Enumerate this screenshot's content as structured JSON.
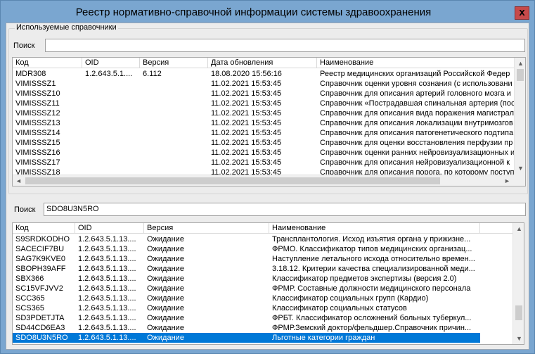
{
  "window": {
    "title": "Реестр нормативно-справочной информации системы здравоохранения",
    "close_glyph": "x"
  },
  "used": {
    "group_caption": "Используемые справочники",
    "search_label": "Поиск",
    "search_value": "",
    "columns": [
      "Код",
      "OID",
      "Версия",
      "Дата обновления",
      "Наименование"
    ],
    "rows": [
      [
        "MDR308",
        "1.2.643.5.1....",
        "6.112",
        "18.08.2020 15:56:16",
        "Реестр медицинских организаций Российской Федер"
      ],
      [
        "VIMISSSZ1",
        "",
        "",
        "11.02.2021 15:53:45",
        "Справочник оценки уровня сознания (с использовани"
      ],
      [
        "VIMISSSZ10",
        "",
        "",
        "11.02.2021 15:53:45",
        "Справочник для описания артерий головного мозга и"
      ],
      [
        "VIMISSSZ11",
        "",
        "",
        "11.02.2021 15:53:45",
        "Справочник «Пострадавшая спинальная артерия (пос"
      ],
      [
        "VIMISSSZ12",
        "",
        "",
        "11.02.2021 15:53:45",
        "Справочник для описания вида поражения магистрал"
      ],
      [
        "VIMISSSZ13",
        "",
        "",
        "11.02.2021 15:53:45",
        "Справочник для описания локализации внутримозгов"
      ],
      [
        "VIMISSSZ14",
        "",
        "",
        "11.02.2021 15:53:45",
        "Справочник для описания патогенетического подтипа"
      ],
      [
        "VIMISSSZ15",
        "",
        "",
        "11.02.2021 15:53:45",
        "Справочник для оценки восстановления перфузии пр"
      ],
      [
        "VIMISSSZ16",
        "",
        "",
        "11.02.2021 15:53:45",
        "Справочник оценки ранних нейровизуализационных и"
      ],
      [
        "VIMISSSZ17",
        "",
        "",
        "11.02.2021 15:53:45",
        "Справочник для описания нейровизуализационной к"
      ],
      [
        "VIMISSSZ18",
        "",
        "",
        "11.02.2021 15:53:45",
        "Справочник для описания порога, по которому поступ"
      ]
    ]
  },
  "bottom": {
    "search_label": "Поиск",
    "search_value": "SDO8U3N5RO",
    "columns": [
      "Код",
      "OID",
      "Версия",
      "Наименование"
    ],
    "rows": [
      [
        "S9SRDKODHO",
        "1.2.643.5.1.13....",
        "Ожидание",
        "Трансплантология. Исход изъятия органа у прижизне..."
      ],
      [
        "SACECIF7BU",
        "1.2.643.5.1.13....",
        "Ожидание",
        "ФРМО. Классификатор типов медицинских организац..."
      ],
      [
        "SAG7K9KVE0",
        "1.2.643.5.1.13....",
        "Ожидание",
        "Наступление летального исхода относительно времен..."
      ],
      [
        "SBOPH39AFF",
        "1.2.643.5.1.13....",
        "Ожидание",
        "3.18.12. Критерии качества специализированной меди..."
      ],
      [
        "SBX366",
        "1.2.643.5.1.13....",
        "Ожидание",
        "Классификатор предметов экспертизы (версия 2.0)"
      ],
      [
        "SC15VFJVV2",
        "1.2.643.5.1.13....",
        "Ожидание",
        "ФРМР. Составные должности медицинского персонала"
      ],
      [
        "SCC365",
        "1.2.643.5.1.13....",
        "Ожидание",
        "Классификатор социальных групп (Кардио)"
      ],
      [
        "SCS365",
        "1.2.643.5.1.13....",
        "Ожидание",
        "Классификатор социальных статусов"
      ],
      [
        "SD3PDETJTA",
        "1.2.643.5.1.13....",
        "Ожидание",
        "ФРБТ. Классификатор осложнений больных туберкул..."
      ],
      [
        "SD44CD6EA3",
        "1.2.643.5.1.13....",
        "Ожидание",
        "ФРМР.Земский доктор/фельдшер.Справочник причин..."
      ],
      [
        "SDO8U3N5RO",
        "1.2.643.5.1.13....",
        "Ожидание",
        "Льготные категории граждан"
      ]
    ],
    "selected_index": 10
  },
  "icons": {
    "scroll_up": "▲",
    "scroll_down": "▼",
    "scroll_left": "◄",
    "scroll_right": "►"
  }
}
